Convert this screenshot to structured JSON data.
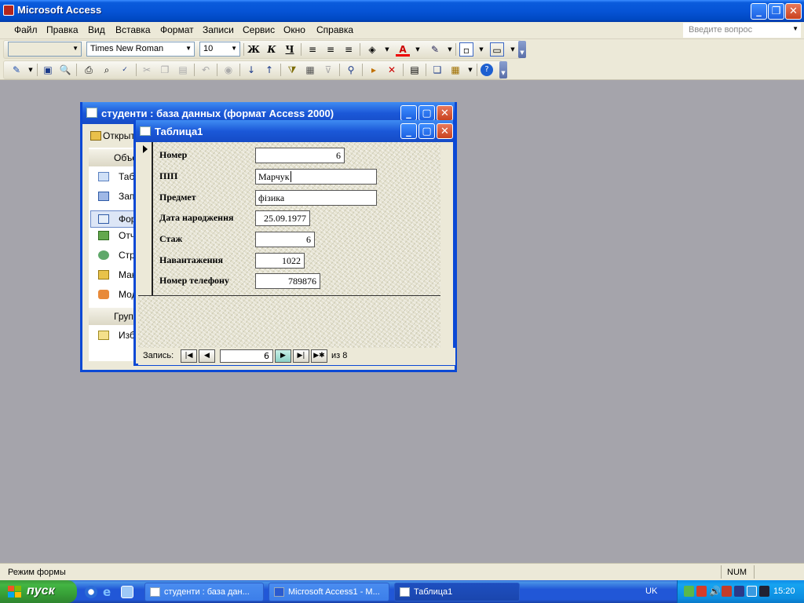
{
  "app": {
    "title": "Microsoft Access"
  },
  "menu": [
    "Файл",
    "Правка",
    "Вид",
    "Вставка",
    "Формат",
    "Записи",
    "Сервис",
    "Окно",
    "Справка"
  ],
  "help_placeholder": "Введите вопрос",
  "format_toolbar": {
    "object_combo": "",
    "font_name": "Times New Roman",
    "font_size": "10",
    "bold": "Ж",
    "italic": "К",
    "underline": "Ч",
    "font_color_glyph": "A"
  },
  "db_window": {
    "title": "студенти : база данных (формат Access 2000)",
    "open_label": "Открыт",
    "objects_header": "Объе",
    "objects": [
      "Таб",
      "Зап",
      "Фор",
      "Отч",
      "Стр",
      "Мак",
      "Мод"
    ],
    "groups_header": "Груп",
    "favorites": "Изб"
  },
  "form_window": {
    "title": "Таблица1",
    "fields": [
      {
        "label": "Номер",
        "value": "6"
      },
      {
        "label": "ПІП",
        "value": "Марчук"
      },
      {
        "label": "Предмет",
        "value": "фізика"
      },
      {
        "label": "Дата народження",
        "value": "25.09.1977"
      },
      {
        "label": "Стаж",
        "value": "6"
      },
      {
        "label": "Навантаження",
        "value": "1022"
      },
      {
        "label": "Номер телефону",
        "value": "789876"
      }
    ],
    "nav": {
      "label": "Запись:",
      "current": "6",
      "of_text": "из  8"
    }
  },
  "statusbar": {
    "mode": "Режим формы",
    "num": "NUM"
  },
  "taskbar": {
    "start": "пуск",
    "tasks": [
      "студенти : база дан...",
      "Microsoft Access1 - M...",
      "Таблица1"
    ],
    "lang": "UK",
    "clock": "15:20"
  }
}
